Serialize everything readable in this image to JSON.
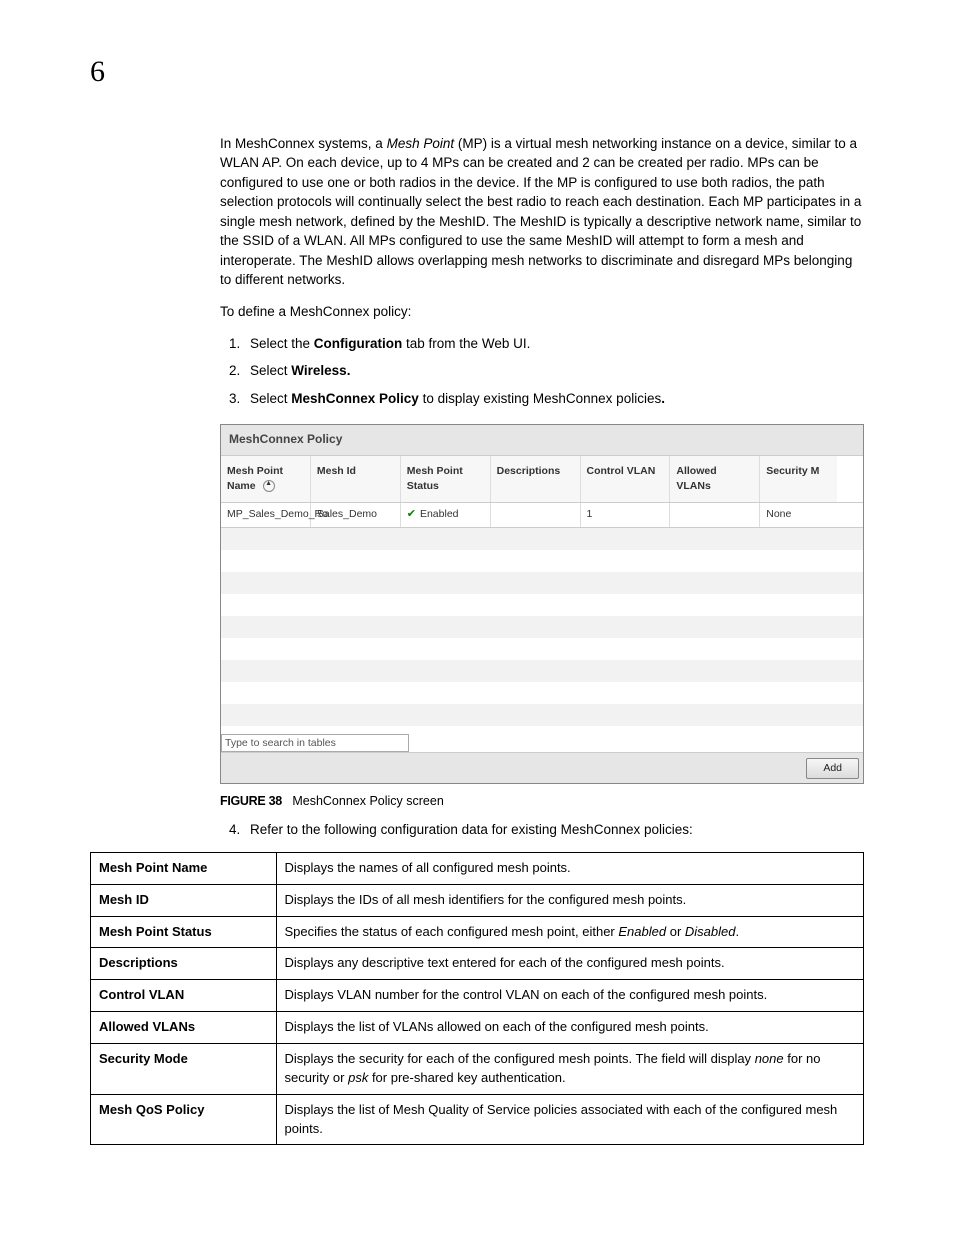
{
  "page_number": "6",
  "intro_paragraph_parts": {
    "p1_a": "In MeshConnex systems, a ",
    "p1_mp_italic": "Mesh Point",
    "p1_b": " (MP) is a virtual mesh networking instance on a device, similar to a WLAN AP. On each device, up to 4 MPs can be created and 2 can be created per radio. MPs can be configured to use one or both radios in the device. If the MP is configured to use both radios, the path selection protocols will continually select the best radio to reach each destination. Each MP participates in a single mesh network, defined by the MeshID. The MeshID is typically a descriptive network name, similar to the SSID of a WLAN. All MPs configured to use the same MeshID will attempt to form a mesh and interoperate. The MeshID allows overlapping mesh networks to discriminate and disregard MPs belonging to different networks."
  },
  "define_line": "To define a MeshConnex policy:",
  "steps": {
    "s1_a": "Select the ",
    "s1_b": "Configuration",
    "s1_c": " tab from the Web UI.",
    "s2_a": "Select ",
    "s2_b": "Wireless.",
    "s3_a": "Select ",
    "s3_b": "MeshConnex Policy",
    "s3_c": " to display existing MeshConnex policies",
    "s3_d": ".",
    "s4": "Refer to the following configuration data for existing MeshConnex policies:"
  },
  "screenshot": {
    "title": "MeshConnex Policy",
    "columns": {
      "c1": "Mesh Point Name",
      "c2": "Mesh Id",
      "c3": "Mesh Point Status",
      "c4": "Descriptions",
      "c5": "Control VLAN",
      "c6": "Allowed VLANs",
      "c7": "Security M"
    },
    "row": {
      "name": "MP_Sales_Demo_Ro",
      "meshid": "Sales_Demo",
      "status": "Enabled",
      "descriptions": "",
      "control_vlan": "1",
      "allowed_vlans": "",
      "security": "None"
    },
    "search_placeholder": "Type to search in tables",
    "add_button": "Add"
  },
  "figure": {
    "num": "FIGURE 38",
    "caption": "MeshConnex Policy screen"
  },
  "definition_table": [
    {
      "term": "Mesh Point Name",
      "desc_parts": [
        "Displays the names of all configured mesh points."
      ]
    },
    {
      "term": "Mesh ID",
      "desc_parts": [
        "Displays the IDs of all mesh identifiers for the configured mesh points."
      ]
    },
    {
      "term": "Mesh Point Status",
      "desc_parts": [
        "Specifies the status of each configured mesh point, either ",
        {
          "i": "Enabled"
        },
        " or ",
        {
          "i": "Disabled"
        },
        "."
      ]
    },
    {
      "term": "Descriptions",
      "desc_parts": [
        "Displays any descriptive text entered for each of the configured mesh points."
      ]
    },
    {
      "term": "Control VLAN",
      "desc_parts": [
        "Displays VLAN number for the control VLAN on each of the configured mesh points."
      ]
    },
    {
      "term": "Allowed VLANs",
      "desc_parts": [
        "Displays the list of VLANs allowed on each of the configured mesh points."
      ]
    },
    {
      "term": "Security Mode",
      "desc_parts": [
        "Displays the security for each of the configured mesh points. The field will display ",
        {
          "i": "none"
        },
        " for no security or ",
        {
          "i": "psk"
        },
        " for pre-shared key authentication."
      ]
    },
    {
      "term": "Mesh QoS Policy",
      "desc_parts": [
        "Displays the list of Mesh Quality of Service policies associated with each of the configured mesh points."
      ]
    }
  ]
}
